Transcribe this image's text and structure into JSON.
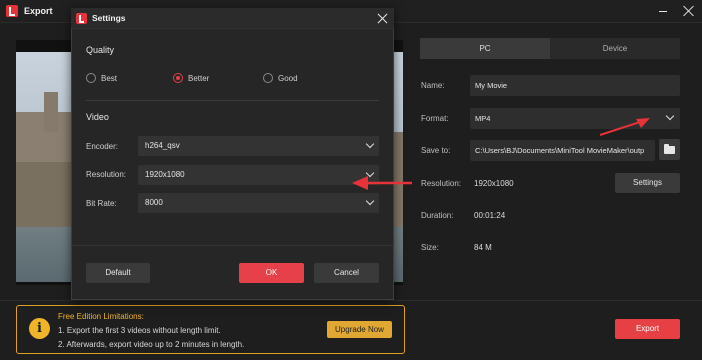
{
  "window": {
    "title": "Export"
  },
  "tabs": [
    {
      "label": "PC"
    },
    {
      "label": "Device"
    }
  ],
  "fields": {
    "name": {
      "label": "Name:",
      "value": "My Movie"
    },
    "format": {
      "label": "Format:",
      "value": "MP4"
    },
    "save_to": {
      "label": "Save to:",
      "value": "C:\\Users\\BJ\\Documents\\MiniTool MovieMaker\\outp"
    },
    "resolution": {
      "label": "Resolution:",
      "value": "1920x1080",
      "button": "Settings"
    },
    "duration": {
      "label": "Duration:",
      "value": "00:01:24"
    },
    "size": {
      "label": "Size:",
      "value": "84 M"
    }
  },
  "limitations": {
    "title": "Free Edition Limitations:",
    "lines": [
      "1. Export the first 3 videos without length limit.",
      "2. Afterwards, export video up to 2 minutes in length."
    ],
    "upgrade_label": "Upgrade Now",
    "icon": "info-icon"
  },
  "export_label": "Export",
  "dialog": {
    "title": "Settings",
    "quality": {
      "title": "Quality",
      "options": [
        {
          "label": "Best",
          "checked": false
        },
        {
          "label": "Better",
          "checked": true
        },
        {
          "label": "Good",
          "checked": false
        }
      ]
    },
    "video": {
      "title": "Video",
      "encoder": {
        "label": "Encoder:",
        "value": "h264_qsv"
      },
      "resolution": {
        "label": "Resolution:",
        "value": "1920x1080"
      },
      "bitrate": {
        "label": "Bit Rate:",
        "value": "8000"
      }
    },
    "buttons": {
      "default": "Default",
      "ok": "OK",
      "cancel": "Cancel"
    }
  },
  "colors": {
    "accent": "#e6404a",
    "warning": "#f0b42a",
    "background": "#1e1e1e"
  }
}
